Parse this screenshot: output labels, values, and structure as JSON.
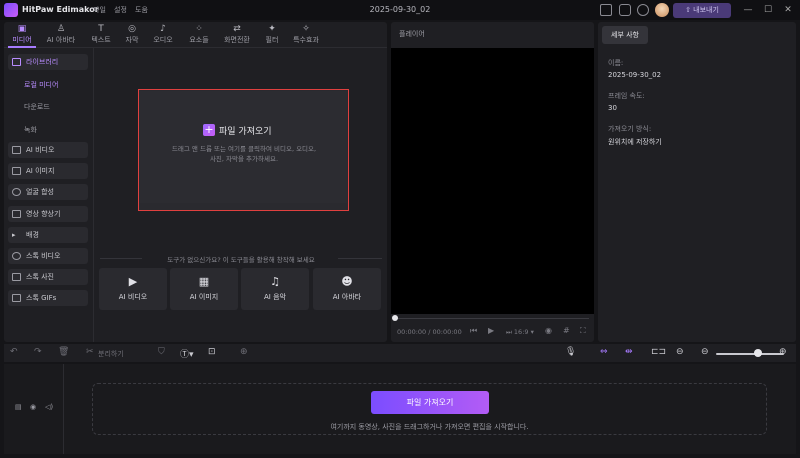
{
  "app": {
    "title": "HitPaw Edimakor",
    "menu": [
      "파일",
      "설정",
      "도움"
    ],
    "project_name": "2025-09-30_02",
    "export_label": "내보내기",
    "window_controls": [
      "minimize-icon",
      "maximize-icon",
      "close-icon"
    ]
  },
  "media_tabs": [
    {
      "label": "미디어",
      "icon": "media-icon",
      "active": true
    },
    {
      "label": "AI 아바타",
      "icon": "avatar-icon"
    },
    {
      "label": "텍스트",
      "icon": "text-icon"
    },
    {
      "label": "자막",
      "icon": "subtitle-icon"
    },
    {
      "label": "오디오",
      "icon": "audio-icon"
    },
    {
      "label": "요소들",
      "icon": "elements-icon"
    },
    {
      "label": "화면전환",
      "icon": "transition-icon"
    },
    {
      "label": "필터",
      "icon": "filter-icon"
    },
    {
      "label": "특수효과",
      "icon": "effects-icon"
    }
  ],
  "sidebar": {
    "library": "라이브러리",
    "library_sub": [
      "로컬 미디어",
      "다운로드",
      "녹화"
    ],
    "items": [
      "AI 비디오",
      "AI 이미지",
      "얼굴 합성",
      "영상 향상기",
      "배경",
      "스톡 비디오",
      "스톡 사진",
      "스톡 GIFs"
    ]
  },
  "import_panel": {
    "button_label": "파일 가져오기",
    "description_line1": "드래그 앤 드롭 또는 여기를 클릭하여 비디오, 오디오,",
    "description_line2": "사진, 자막을 추가하세요."
  },
  "tools": {
    "hint": "도구가 없으신가요? 이 도구들을 활용해 창작해 보세요",
    "items": [
      {
        "label": "AI 비디오",
        "icon": "ai-video-icon"
      },
      {
        "label": "AI 이미지",
        "icon": "ai-image-icon"
      },
      {
        "label": "AI 음악",
        "icon": "ai-music-icon"
      },
      {
        "label": "AI 아바타",
        "icon": "ai-avatar-icon"
      }
    ]
  },
  "player": {
    "label": "플레이어",
    "timecode": "00:00:00 / 00:00:00",
    "aspect": "16:9"
  },
  "details": {
    "tab": "세부 사항",
    "fields": [
      {
        "label": "이름:",
        "value": "2025-09-30_02"
      },
      {
        "label": "프레임 속도:",
        "value": "30"
      },
      {
        "label": "가져오기 방식:",
        "value": "원위치에 저장하기"
      }
    ]
  },
  "timeline_toolbar": {
    "split_label": "분리하기"
  },
  "timeline": {
    "import_label": "파일 가져오기",
    "description": "여기까지 동영상, 사진을 드래그하거나 가져오면 편집을 시작합니다."
  },
  "colors": {
    "accent": "#a77bff",
    "highlight_border": "#e0403f",
    "background": "#151518",
    "panel": "#1f1f23"
  }
}
